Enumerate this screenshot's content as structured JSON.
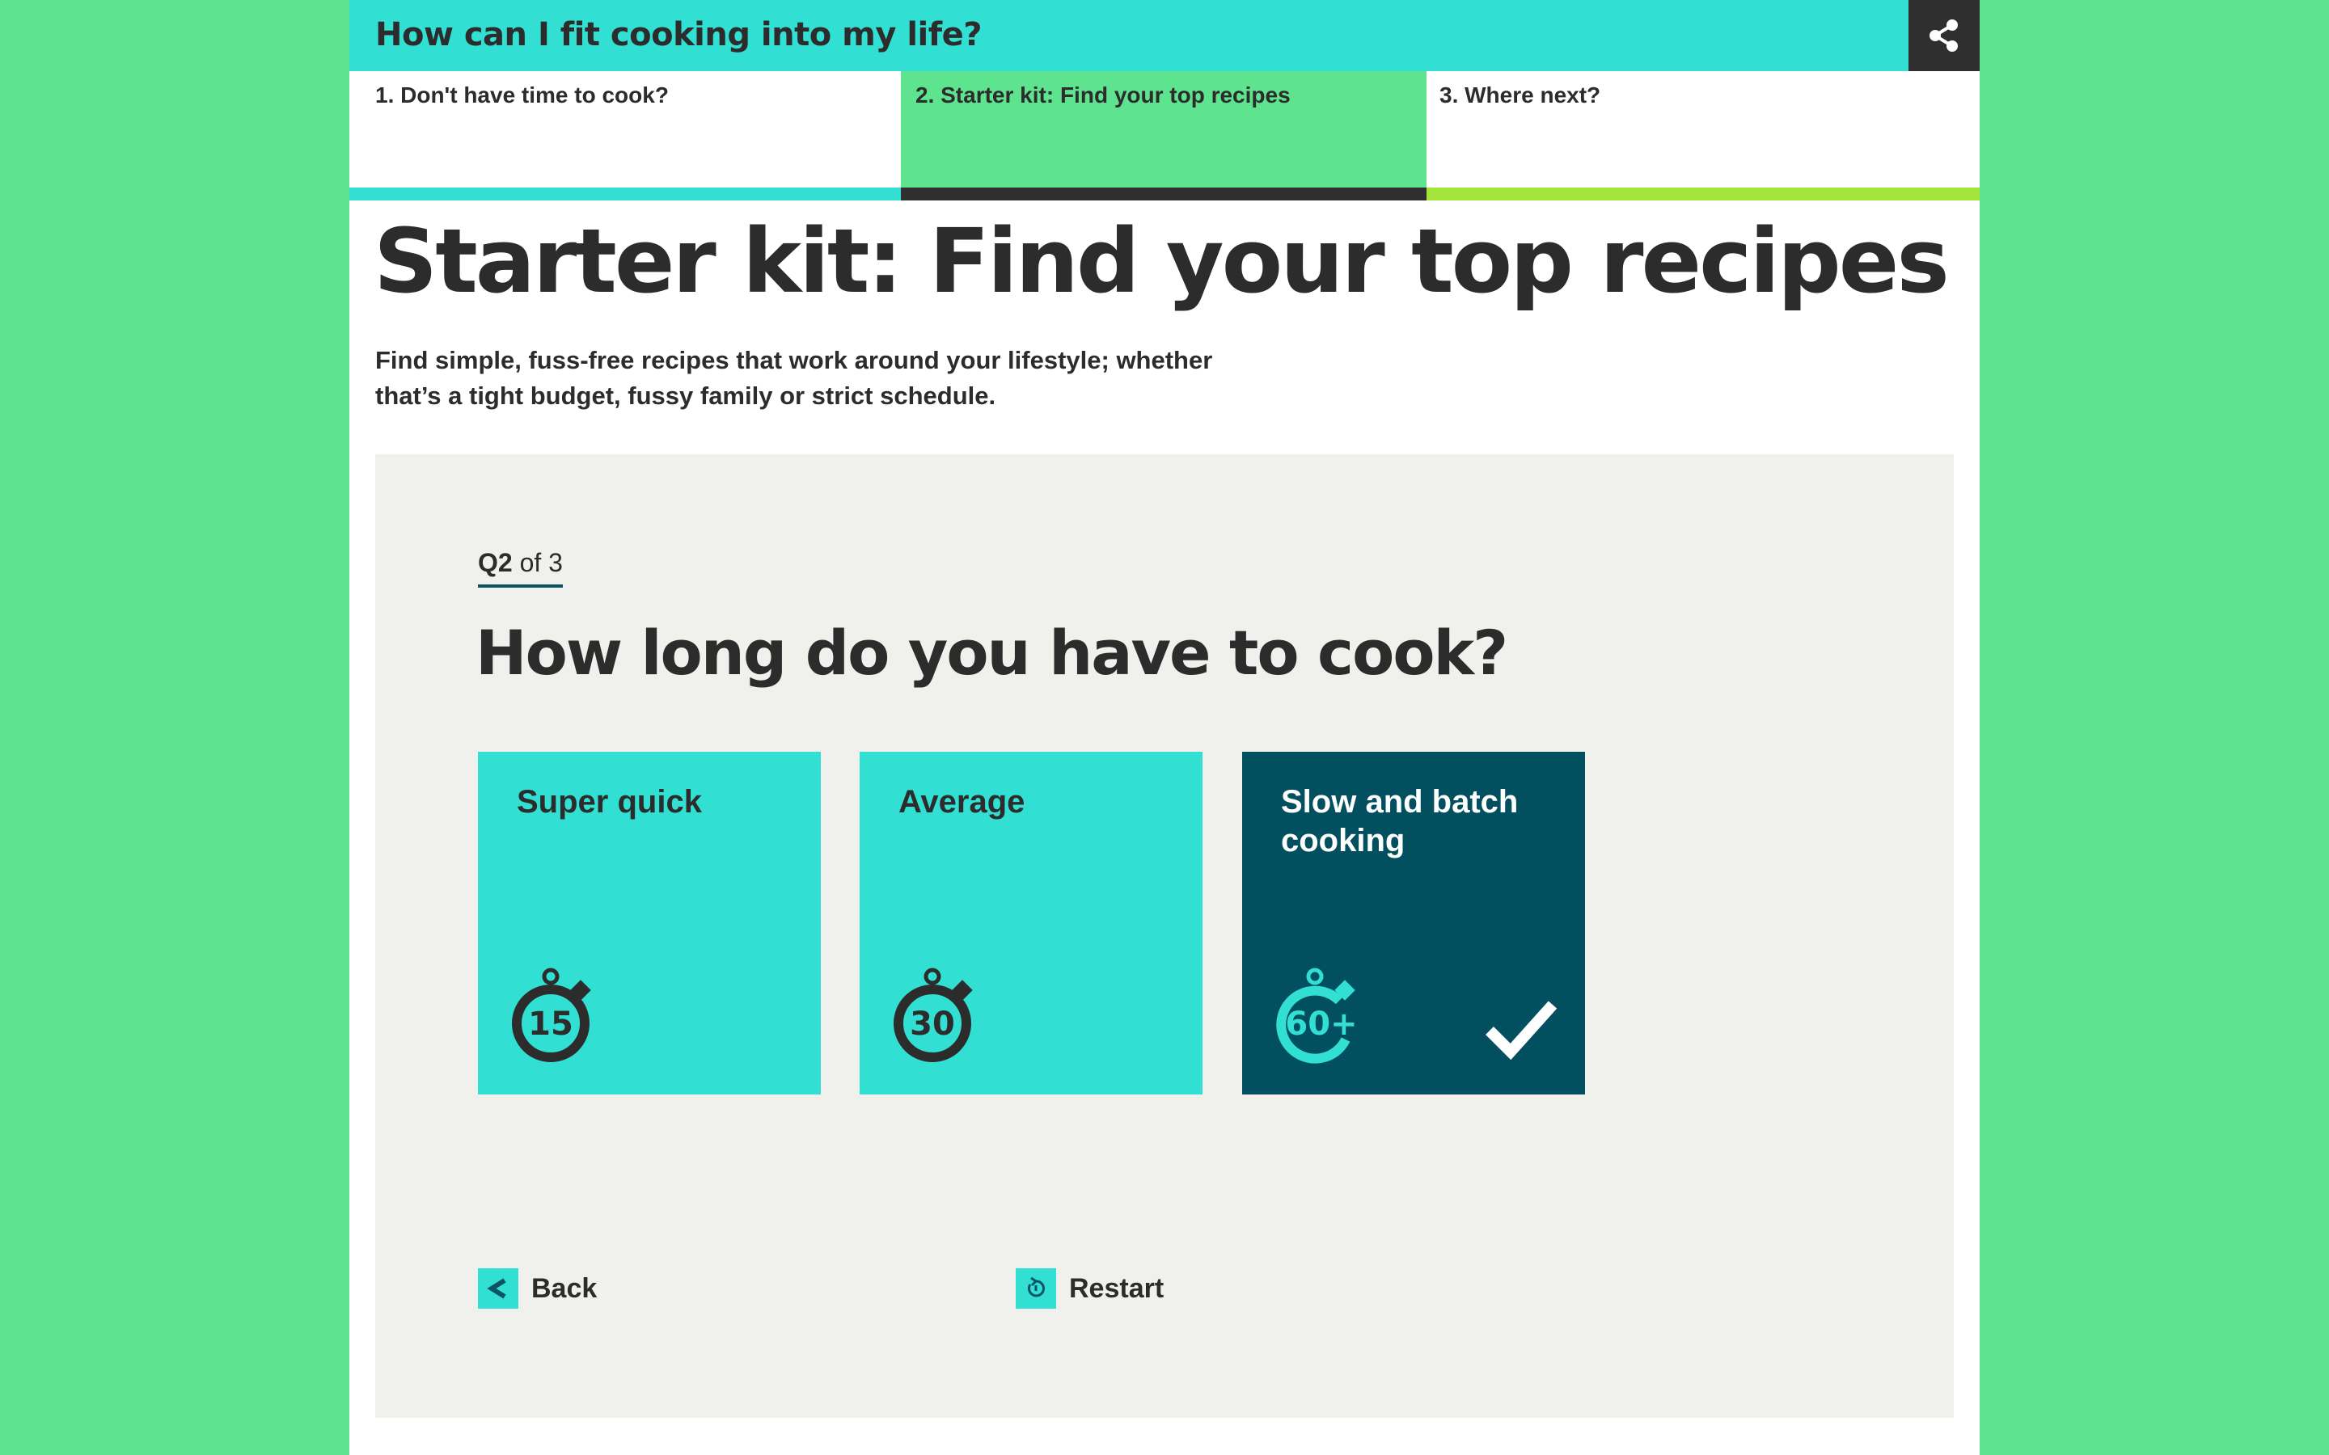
{
  "header": {
    "title": "How can I fit cooking into my life?",
    "share_icon": "share-icon"
  },
  "steps": [
    {
      "label": "1. Don't have time to cook?",
      "color": "#31dfd3",
      "active": false
    },
    {
      "label": "2. Starter kit: Find your top recipes",
      "color": "#2f2f2f",
      "active": true
    },
    {
      "label": "3. Where next?",
      "color": "#a4e43a",
      "active": false
    }
  ],
  "main": {
    "title": "Starter kit: Find your top recipes",
    "intro": "Find simple, fuss-free recipes that work around your lifestyle; whether that’s a tight budget, fussy family or strict schedule."
  },
  "quiz": {
    "counter_current": "Q2",
    "counter_rest": "of 3",
    "question": "How long do you have to cook?",
    "options": [
      {
        "label": "Super quick",
        "icon": "stopwatch-15-icon",
        "icon_text": "15",
        "selected": false
      },
      {
        "label": "Average",
        "icon": "stopwatch-30-icon",
        "icon_text": "30",
        "selected": false
      },
      {
        "label": "Slow and batch cooking",
        "icon": "stopwatch-60-plus-icon",
        "icon_text": "60+",
        "selected": true
      }
    ],
    "back_label": "Back",
    "restart_label": "Restart"
  },
  "colors": {
    "background": "#5ee38f",
    "accent_turquoise": "#31dfd3",
    "selected_option": "#02505f",
    "panel": "#f0f0ec",
    "text": "#2c2c2c"
  }
}
